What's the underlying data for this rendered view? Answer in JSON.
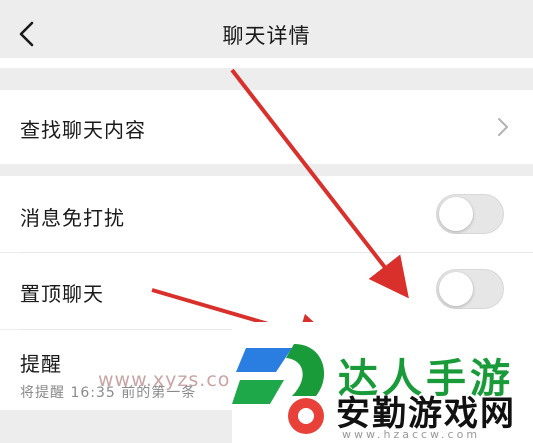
{
  "header": {
    "title": "聊天详情",
    "back_icon": "chevron-left-icon"
  },
  "rows": {
    "search_history": {
      "label": "查找聊天内容"
    },
    "mute": {
      "label": "消息免打扰",
      "on": false
    },
    "pin": {
      "label": "置顶聊天",
      "on": false
    },
    "reminder": {
      "label": "提醒",
      "sub": "将提醒 16:35 前的第一条"
    }
  },
  "watermark": {
    "url": "www.xyzs.com",
    "brand_top": "达人手游",
    "brand": "安勤游戏网",
    "domain": "www.hzaccw.com"
  },
  "colors": {
    "background": "#ededed",
    "arrow": "#d9302c",
    "toggle_off": "#e6e6e6",
    "brand_green": "#1a9b3a"
  }
}
